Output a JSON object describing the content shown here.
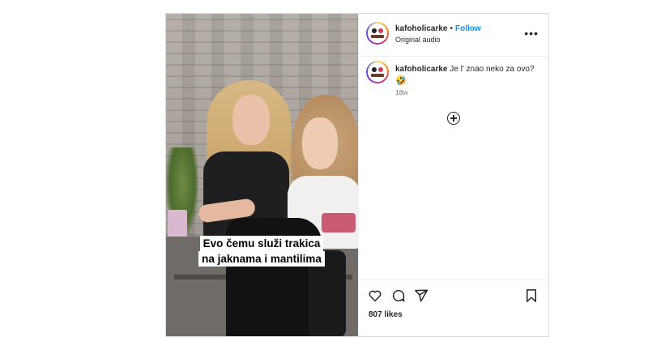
{
  "post": {
    "username": "kafoholicarke",
    "separator": "•",
    "follow_label": "Follow",
    "audio": "Original audio",
    "more_label": "•••"
  },
  "media": {
    "caption_line1": "Evo čemu služi trakica",
    "caption_line2": "na jaknama i mantilima"
  },
  "comment": {
    "username": "kafoholicarke",
    "text": "Je l' znao neko za ovo?",
    "emoji": "🤣",
    "time": "18w"
  },
  "actions": {
    "likes": "807 likes"
  },
  "colors": {
    "follow_blue": "#0095f6",
    "text_dark": "#262626",
    "text_muted": "#737373",
    "border": "#dbdbdb"
  },
  "icons": [
    "heart-icon",
    "comment-icon",
    "share-icon",
    "bookmark-icon",
    "add-icon",
    "more-icon"
  ]
}
